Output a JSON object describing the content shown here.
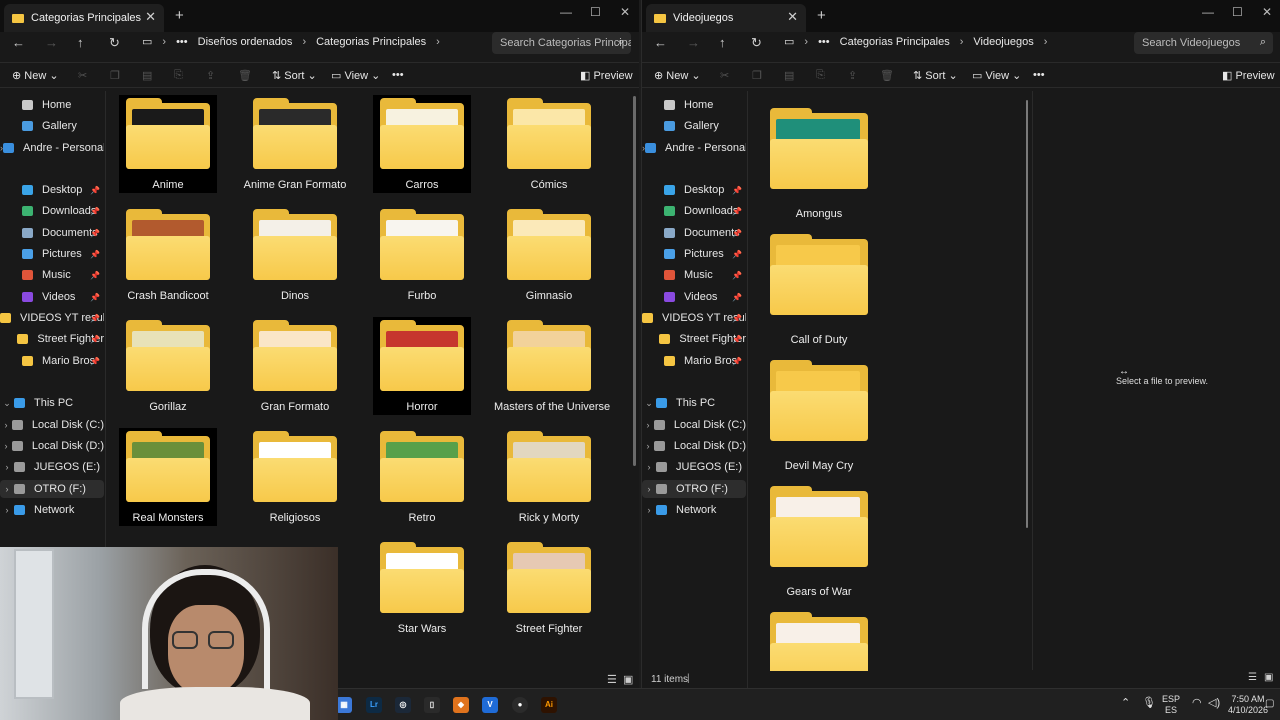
{
  "left": {
    "tab_title": "Categorias Principales",
    "breadcrumb": [
      "Diseños ordenados",
      "Categorias Principales"
    ],
    "search_placeholder": "Search Categorias Principales",
    "toolbar": {
      "new": "New",
      "sort": "Sort",
      "view": "View",
      "more": "•••",
      "preview": "Preview"
    },
    "sidebar": {
      "home": "Home",
      "gallery": "Gallery",
      "onedrive": "Andre - Personal",
      "desktop": "Desktop",
      "downloads": "Downloads",
      "documents": "Documents",
      "pictures": "Pictures",
      "music": "Music",
      "videos": "Videos",
      "videos_yt": "VIDEOS YT resubir",
      "street_fighter": "Street Fighter",
      "mario": "Mario Bros",
      "this_pc": "This PC",
      "disk_c": "Local Disk (C:)",
      "disk_d": "Local Disk (D:)",
      "disk_e": "JUEGOS (E:)",
      "disk_f": "OTRO (F:)",
      "network": "Network"
    },
    "folders": [
      "Anime",
      "Anime Gran Formato",
      "Carros",
      "Cómics",
      "Crash Bandicoot",
      "Dinos",
      "Furbo",
      "Gimnasio",
      "Gorillaz",
      "Gran Formato",
      "Horror",
      "Masters of the Universe",
      "Real Monsters",
      "Religiosos",
      "Retro",
      "Rick y Morty",
      "Star Wars",
      "Street Fighter"
    ]
  },
  "right": {
    "tab_title": "Videojuegos",
    "breadcrumb": [
      "Categorias Principales",
      "Videojuegos"
    ],
    "search_placeholder": "Search Videojuegos",
    "toolbar": {
      "new": "New",
      "sort": "Sort",
      "view": "View",
      "more": "•••",
      "preview": "Preview"
    },
    "sidebar": {
      "home": "Home",
      "gallery": "Gallery",
      "onedrive": "Andre - Personal",
      "desktop": "Desktop",
      "downloads": "Downloads",
      "documents": "Documents",
      "pictures": "Pictures",
      "music": "Music",
      "videos": "Videos",
      "videos_yt": "VIDEOS YT resubir",
      "street_fighter": "Street Fighter",
      "mario": "Mario Bros",
      "this_pc": "This PC",
      "disk_c": "Local Disk (C:)",
      "disk_d": "Local Disk (D:)",
      "disk_e": "JUEGOS (E:)",
      "disk_f": "OTRO (F:)",
      "network": "Network"
    },
    "folders": [
      "Amongus",
      "Call of Duty",
      "Devil May Cry",
      "Gears of War"
    ],
    "status_items": "11 items",
    "preview_message": "Select a file to preview."
  },
  "taskbar": {
    "lang_top": "ESP",
    "lang_bottom": "ES",
    "time": "7:50 AM",
    "date": "4/10/2026",
    "apps": [
      "Lr",
      "Ai",
      "V"
    ]
  }
}
